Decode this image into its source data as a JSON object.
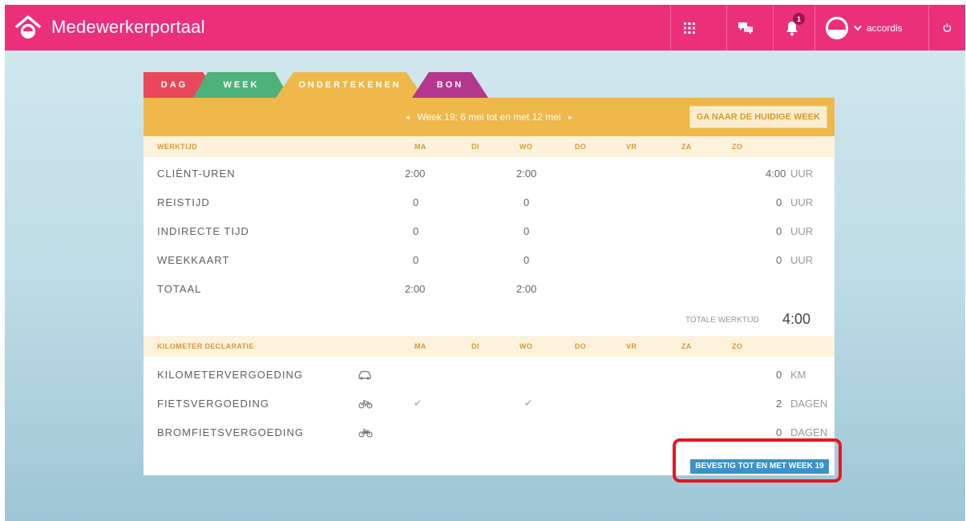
{
  "header": {
    "title": "Medewerkerportaal",
    "notification_count": "1",
    "user_name": "accordis",
    "icons": [
      "home-logo-icon",
      "apps-grid-icon",
      "chat-icon",
      "bell-icon",
      "user-avatar-icon",
      "chevron-down-icon",
      "power-icon"
    ],
    "colors": {
      "brand": "#ec2f7a"
    }
  },
  "tabs": [
    {
      "label": "DAG",
      "color": "#e8485a"
    },
    {
      "label": "WEEK",
      "color": "#4db27a"
    },
    {
      "label": "ONDERTEKENEN",
      "color": "#efb84a",
      "active": true
    },
    {
      "label": "BON",
      "color": "#b3378d"
    }
  ],
  "week_nav": {
    "label": "Week 19: 6 mei tot en met 12 mei",
    "prev_arrow": "◄",
    "next_arrow": "►",
    "goto_current": "GA NAAR DE HUIDIGE WEEK"
  },
  "werktijd": {
    "header": "WERKTIJD",
    "days": [
      "MA",
      "DI",
      "WO",
      "DO",
      "VR",
      "ZA",
      "ZO"
    ],
    "rows": [
      {
        "label": "CLIËNT-UREN",
        "ma": "2:00",
        "wo": "2:00",
        "total": "4:00",
        "unit": "UUR"
      },
      {
        "label": "REISTIJD",
        "ma": "0",
        "wo": "0",
        "total": "0",
        "unit": "UUR"
      },
      {
        "label": "INDIRECTE TIJD",
        "ma": "0",
        "wo": "0",
        "total": "0",
        "unit": "UUR"
      },
      {
        "label": "WEEKKAART",
        "ma": "0",
        "wo": "0",
        "total": "0",
        "unit": "UUR"
      },
      {
        "label": "TOTAAL",
        "ma": "2:00",
        "wo": "2:00"
      }
    ],
    "totale_werktijd_label": "TOTALE WERKTIJD",
    "totale_werktijd_value": "4:00"
  },
  "kilometer": {
    "header": "KILOMETER DECLARATIE",
    "days": [
      "MA",
      "DI",
      "WO",
      "DO",
      "VR",
      "ZA",
      "ZO"
    ],
    "rows": [
      {
        "label": "KILOMETERVERGOEDING",
        "icon": "car-icon",
        "total": "0",
        "unit": "KM"
      },
      {
        "label": "FIETSVERGOEDING",
        "icon": "bicycle-icon",
        "ma_check": "✔",
        "wo_check": "✔",
        "total": "2",
        "unit": "DAGEN"
      },
      {
        "label": "BROMFIETSVERGOEDING",
        "icon": "moped-icon",
        "total": "0",
        "unit": "DAGEN"
      }
    ]
  },
  "confirm_button": "BEVESTIG TOT EN MET WEEK 19",
  "highlight_color": "#e8151f"
}
